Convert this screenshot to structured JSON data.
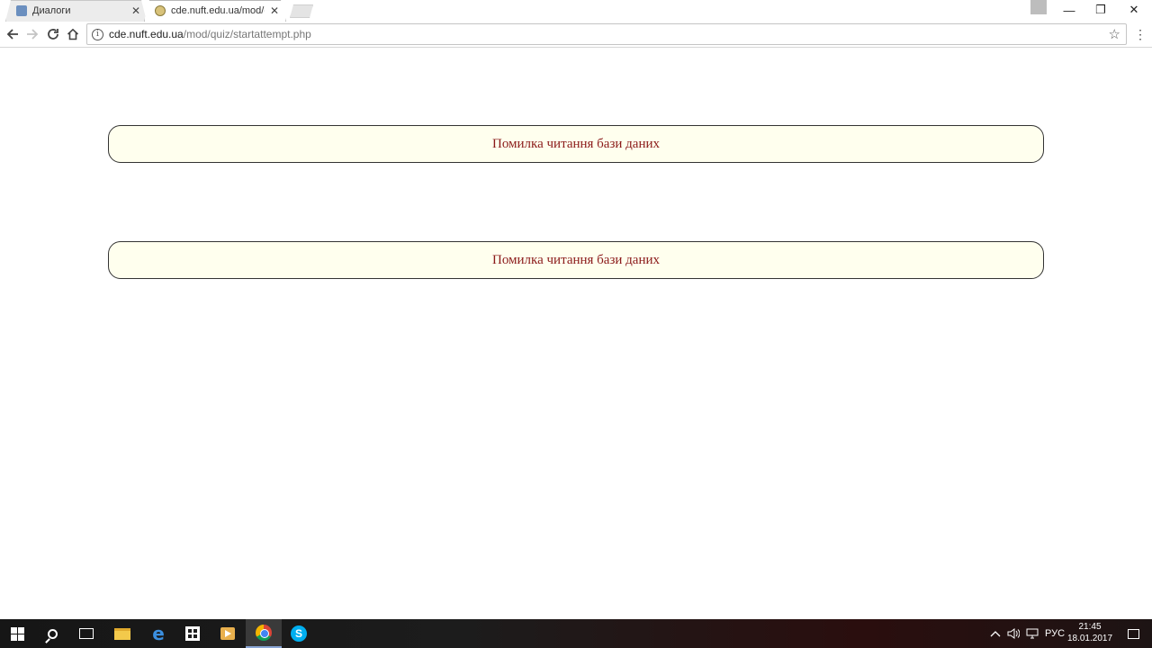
{
  "browser": {
    "tabs": [
      {
        "title": "Диалоги",
        "active": false,
        "favicon": "dialog-icon"
      },
      {
        "title": "cde.nuft.edu.ua/mod/qu",
        "active": true,
        "favicon": "moodle-icon"
      }
    ],
    "tab_close_glyph": "✕",
    "window_controls": {
      "minimize": "—",
      "restore": "❐",
      "close": "✕"
    },
    "address": {
      "host": "cde.nuft.edu.ua",
      "path": "/mod/quiz/startattempt.php"
    }
  },
  "page": {
    "errors": [
      "Помилка читання бази даних",
      "Помилка читання бази даних"
    ],
    "colors": {
      "error_text": "#8b1a1a",
      "error_bg": "#ffffee"
    }
  },
  "taskbar": {
    "apps": [
      "start-icon",
      "search-icon",
      "task-view-icon",
      "file-explorer-icon",
      "edge-icon",
      "store-icon",
      "media-player-icon",
      "chrome-icon",
      "skype-icon"
    ],
    "tray": {
      "language": "РУС",
      "time": "21:45",
      "date": "18.01.2017"
    }
  }
}
